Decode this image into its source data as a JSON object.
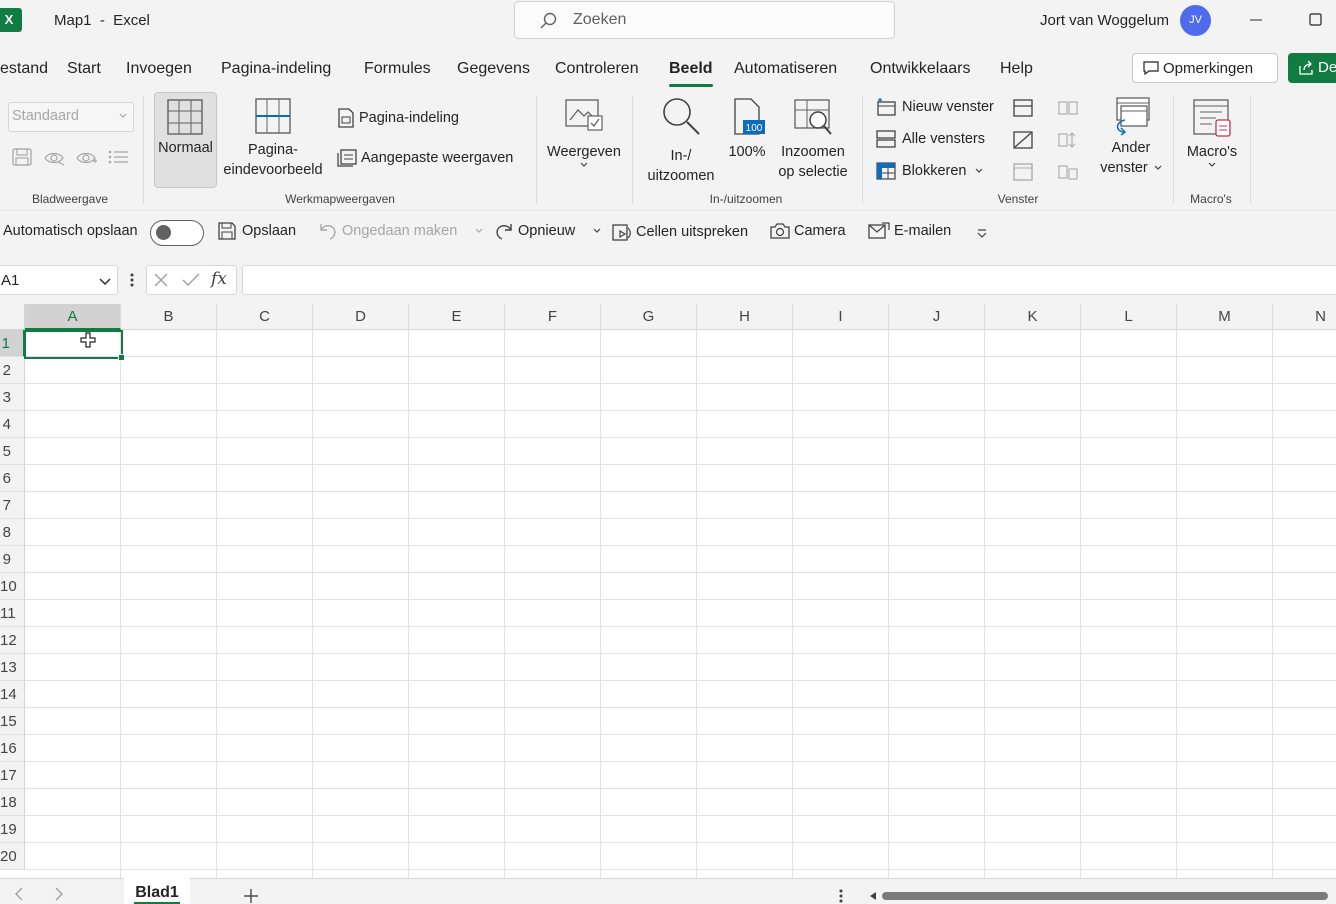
{
  "titlebar": {
    "app_icon": "excel-logo",
    "app_letter": "X",
    "title": "Map1  -  Excel",
    "search_placeholder": "Zoeken",
    "user_name": "Jort van Woggelum",
    "avatar_initials": "JV"
  },
  "tabs": [
    {
      "label": "estand"
    },
    {
      "label": "Start"
    },
    {
      "label": "Invoegen"
    },
    {
      "label": "Pagina-indeling"
    },
    {
      "label": "Formules"
    },
    {
      "label": "Gegevens"
    },
    {
      "label": "Controleren"
    },
    {
      "label": "Beeld",
      "active": true
    },
    {
      "label": "Automatiseren"
    },
    {
      "label": "Ontwikkelaars"
    },
    {
      "label": "Help"
    }
  ],
  "tab_actions": {
    "comments_label": "Opmerkingen",
    "share_label": "De"
  },
  "ribbon": {
    "bladweergave": {
      "dropdown_value": "Standaard",
      "label": "Bladweergave"
    },
    "werkmapweergaven": {
      "normaal": "Normaal",
      "pagina_eindevoorbeeld_1": "Pagina-",
      "pagina_eindevoorbeeld_2": "eindevoorbeeld",
      "pagina_indeling": "Pagina-indeling",
      "aangepaste_weergaven": "Aangepaste weergaven",
      "label": "Werkmapweergaven"
    },
    "weergeven": {
      "label": "Weergeven"
    },
    "zoom": {
      "inuit_1": "In-/",
      "inuit_2": "uitzoomen",
      "pct": "100%",
      "sel_1": "Inzoomen",
      "sel_2": "op selectie",
      "label": "In-/uitzoomen"
    },
    "venster": {
      "nieuw": "Nieuw venster",
      "alle": "Alle vensters",
      "blokkeren": "Blokkeren",
      "ander_1": "Ander",
      "ander_2": "venster",
      "label": "Venster"
    },
    "macros": {
      "btn": "Macro's",
      "label": "Macro's"
    }
  },
  "qat": {
    "autosave": "Automatisch opslaan",
    "save": "Opslaan",
    "undo": "Ongedaan maken",
    "redo": "Opnieuw",
    "speak": "Cellen uitspreken",
    "camera": "Camera",
    "email": "E-mailen"
  },
  "formula_bar": {
    "name_box": "A1",
    "fx": "fx",
    "formula": ""
  },
  "grid": {
    "columns": [
      "A",
      "B",
      "C",
      "D",
      "E",
      "F",
      "G",
      "H",
      "I",
      "J",
      "K",
      "L",
      "M",
      "N"
    ],
    "rows": [
      "1",
      "2",
      "3",
      "4",
      "5",
      "6",
      "7",
      "8",
      "9",
      "10",
      "11",
      "12",
      "13",
      "14",
      "15",
      "16",
      "17",
      "18",
      "19",
      "20"
    ],
    "selected_cell": "A1"
  },
  "sheets": {
    "tabs": [
      "Blad1"
    ],
    "active": "Blad1"
  },
  "colors": {
    "accent": "#107c41",
    "chrome": "#f3f3f3",
    "avatar": "#4f6bed"
  }
}
